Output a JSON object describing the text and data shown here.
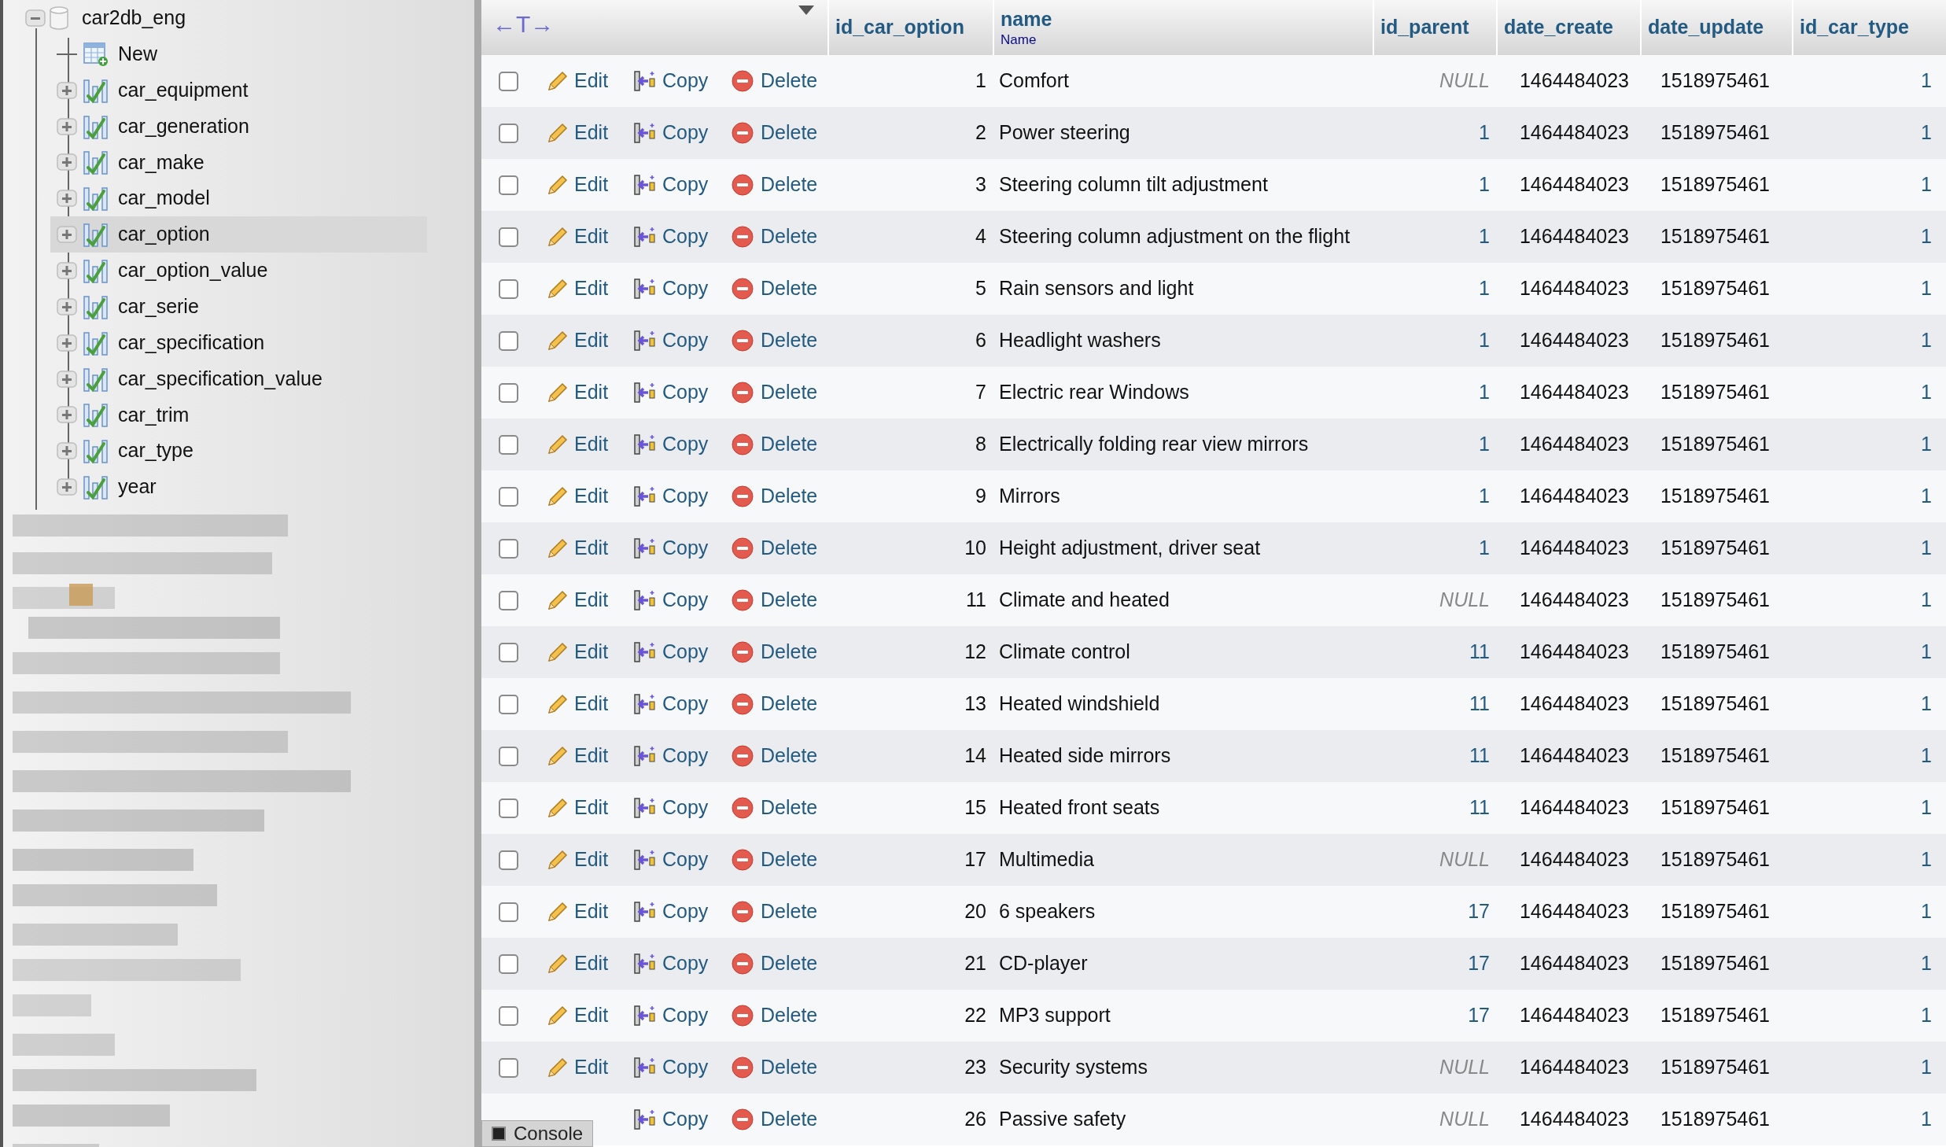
{
  "sidebar": {
    "database": {
      "name": "car2db_eng",
      "expanded": true
    },
    "items": [
      {
        "kind": "new",
        "label": "New",
        "selected": false
      },
      {
        "kind": "table",
        "label": "car_equipment",
        "selected": false
      },
      {
        "kind": "table",
        "label": "car_generation",
        "selected": false
      },
      {
        "kind": "table",
        "label": "car_make",
        "selected": false
      },
      {
        "kind": "table",
        "label": "car_model",
        "selected": false
      },
      {
        "kind": "table",
        "label": "car_option",
        "selected": true
      },
      {
        "kind": "table",
        "label": "car_option_value",
        "selected": false
      },
      {
        "kind": "table",
        "label": "car_serie",
        "selected": false
      },
      {
        "kind": "table",
        "label": "car_specification",
        "selected": false
      },
      {
        "kind": "table",
        "label": "car_specification_value",
        "selected": false
      },
      {
        "kind": "table",
        "label": "car_trim",
        "selected": false
      },
      {
        "kind": "table",
        "label": "car_type",
        "selected": false
      },
      {
        "kind": "table",
        "label": "year",
        "selected": false
      }
    ]
  },
  "table": {
    "column_toggle": "←T→",
    "columns": [
      {
        "label": "id_car_option"
      },
      {
        "label": "name",
        "comment": "Name"
      },
      {
        "label": "id_parent"
      },
      {
        "label": "date_create"
      },
      {
        "label": "date_update"
      },
      {
        "label": "id_car_type"
      }
    ],
    "rows": [
      {
        "checked": false,
        "edit": "Edit",
        "copy": "Copy",
        "delete": "Delete",
        "id": "1",
        "name": "Comfort",
        "id_parent": "NULL",
        "parent_null": true,
        "date_create": "1464484023",
        "date_update": "1518975461",
        "id_car_type": "1"
      },
      {
        "checked": false,
        "edit": "Edit",
        "copy": "Copy",
        "delete": "Delete",
        "id": "2",
        "name": "Power steering",
        "id_parent": "1",
        "parent_null": false,
        "date_create": "1464484023",
        "date_update": "1518975461",
        "id_car_type": "1"
      },
      {
        "checked": false,
        "edit": "Edit",
        "copy": "Copy",
        "delete": "Delete",
        "id": "3",
        "name": "Steering column tilt adjustment",
        "id_parent": "1",
        "parent_null": false,
        "date_create": "1464484023",
        "date_update": "1518975461",
        "id_car_type": "1"
      },
      {
        "checked": false,
        "edit": "Edit",
        "copy": "Copy",
        "delete": "Delete",
        "id": "4",
        "name": "Steering column adjustment on the flight",
        "id_parent": "1",
        "parent_null": false,
        "date_create": "1464484023",
        "date_update": "1518975461",
        "id_car_type": "1"
      },
      {
        "checked": false,
        "edit": "Edit",
        "copy": "Copy",
        "delete": "Delete",
        "id": "5",
        "name": "Rain sensors and light",
        "id_parent": "1",
        "parent_null": false,
        "date_create": "1464484023",
        "date_update": "1518975461",
        "id_car_type": "1"
      },
      {
        "checked": false,
        "edit": "Edit",
        "copy": "Copy",
        "delete": "Delete",
        "id": "6",
        "name": "Headlight washers",
        "id_parent": "1",
        "parent_null": false,
        "date_create": "1464484023",
        "date_update": "1518975461",
        "id_car_type": "1"
      },
      {
        "checked": false,
        "edit": "Edit",
        "copy": "Copy",
        "delete": "Delete",
        "id": "7",
        "name": "Electric rear Windows",
        "id_parent": "1",
        "parent_null": false,
        "date_create": "1464484023",
        "date_update": "1518975461",
        "id_car_type": "1"
      },
      {
        "checked": false,
        "edit": "Edit",
        "copy": "Copy",
        "delete": "Delete",
        "id": "8",
        "name": "Electrically folding rear view mirrors",
        "id_parent": "1",
        "parent_null": false,
        "date_create": "1464484023",
        "date_update": "1518975461",
        "id_car_type": "1"
      },
      {
        "checked": false,
        "edit": "Edit",
        "copy": "Copy",
        "delete": "Delete",
        "id": "9",
        "name": "Mirrors",
        "id_parent": "1",
        "parent_null": false,
        "date_create": "1464484023",
        "date_update": "1518975461",
        "id_car_type": "1"
      },
      {
        "checked": false,
        "edit": "Edit",
        "copy": "Copy",
        "delete": "Delete",
        "id": "10",
        "name": "Height adjustment, driver seat",
        "id_parent": "1",
        "parent_null": false,
        "date_create": "1464484023",
        "date_update": "1518975461",
        "id_car_type": "1"
      },
      {
        "checked": false,
        "edit": "Edit",
        "copy": "Copy",
        "delete": "Delete",
        "id": "11",
        "name": "Climate and heated",
        "id_parent": "NULL",
        "parent_null": true,
        "date_create": "1464484023",
        "date_update": "1518975461",
        "id_car_type": "1"
      },
      {
        "checked": false,
        "edit": "Edit",
        "copy": "Copy",
        "delete": "Delete",
        "id": "12",
        "name": "Climate control",
        "id_parent": "11",
        "parent_null": false,
        "date_create": "1464484023",
        "date_update": "1518975461",
        "id_car_type": "1"
      },
      {
        "checked": false,
        "edit": "Edit",
        "copy": "Copy",
        "delete": "Delete",
        "id": "13",
        "name": "Heated windshield",
        "id_parent": "11",
        "parent_null": false,
        "date_create": "1464484023",
        "date_update": "1518975461",
        "id_car_type": "1"
      },
      {
        "checked": false,
        "edit": "Edit",
        "copy": "Copy",
        "delete": "Delete",
        "id": "14",
        "name": "Heated side mirrors",
        "id_parent": "11",
        "parent_null": false,
        "date_create": "1464484023",
        "date_update": "1518975461",
        "id_car_type": "1"
      },
      {
        "checked": false,
        "edit": "Edit",
        "copy": "Copy",
        "delete": "Delete",
        "id": "15",
        "name": "Heated front seats",
        "id_parent": "11",
        "parent_null": false,
        "date_create": "1464484023",
        "date_update": "1518975461",
        "id_car_type": "1"
      },
      {
        "checked": false,
        "edit": "Edit",
        "copy": "Copy",
        "delete": "Delete",
        "id": "17",
        "name": "Multimedia",
        "id_parent": "NULL",
        "parent_null": true,
        "date_create": "1464484023",
        "date_update": "1518975461",
        "id_car_type": "1"
      },
      {
        "checked": false,
        "edit": "Edit",
        "copy": "Copy",
        "delete": "Delete",
        "id": "20",
        "name": "6 speakers",
        "id_parent": "17",
        "parent_null": false,
        "date_create": "1464484023",
        "date_update": "1518975461",
        "id_car_type": "1"
      },
      {
        "checked": false,
        "edit": "Edit",
        "copy": "Copy",
        "delete": "Delete",
        "id": "21",
        "name": "CD-player",
        "id_parent": "17",
        "parent_null": false,
        "date_create": "1464484023",
        "date_update": "1518975461",
        "id_car_type": "1"
      },
      {
        "checked": false,
        "edit": "Edit",
        "copy": "Copy",
        "delete": "Delete",
        "id": "22",
        "name": "MP3 support",
        "id_parent": "17",
        "parent_null": false,
        "date_create": "1464484023",
        "date_update": "1518975461",
        "id_car_type": "1"
      },
      {
        "checked": false,
        "edit": "Edit",
        "copy": "Copy",
        "delete": "Delete",
        "id": "23",
        "name": "Security systems",
        "id_parent": "NULL",
        "parent_null": true,
        "date_create": "1464484023",
        "date_update": "1518975461",
        "id_car_type": "1"
      },
      {
        "copy": "Copy",
        "delete": "Delete",
        "id": "26",
        "name": "Passive safety",
        "id_parent": "NULL",
        "parent_null": true,
        "date_create": "1464484023",
        "date_update": "1518975461",
        "id_car_type": "1"
      }
    ]
  },
  "console": {
    "label": "Console"
  }
}
